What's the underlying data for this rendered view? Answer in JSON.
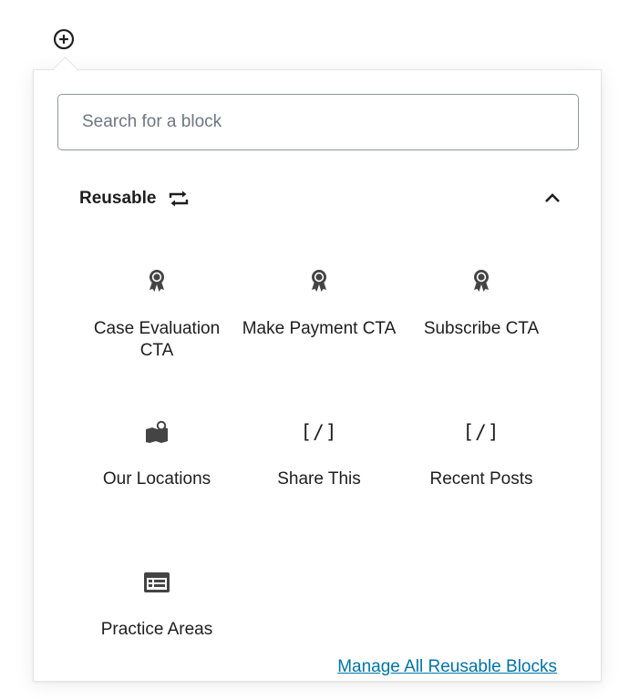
{
  "toolbar": {
    "add_block_icon": "plus-circle-icon"
  },
  "search": {
    "placeholder": "Search for a block",
    "value": ""
  },
  "panel": {
    "title": "Reusable",
    "title_icon": "reusable-icon",
    "toggle_icon": "chevron-up-icon",
    "expanded": true
  },
  "blocks": [
    {
      "label": "Case Evaluation CTA",
      "icon": "award-icon"
    },
    {
      "label": "Make Payment CTA",
      "icon": "award-icon"
    },
    {
      "label": "Subscribe CTA",
      "icon": "award-icon"
    },
    {
      "label": "Our Locations",
      "icon": "map-icon"
    },
    {
      "label": "Share This",
      "icon": "shortcode-icon",
      "glyph": "[/]"
    },
    {
      "label": "Recent Posts",
      "icon": "shortcode-icon",
      "glyph": "[/]"
    },
    {
      "label": "Practice Areas",
      "icon": "list-view-icon"
    }
  ],
  "footer": {
    "manage_link": "Manage All Reusable Blocks"
  },
  "colors": {
    "link": "#0073aa",
    "text": "#1e1e1e",
    "border": "#e2e4e7",
    "input_border": "#8d96a0",
    "placeholder": "#6c7781"
  }
}
